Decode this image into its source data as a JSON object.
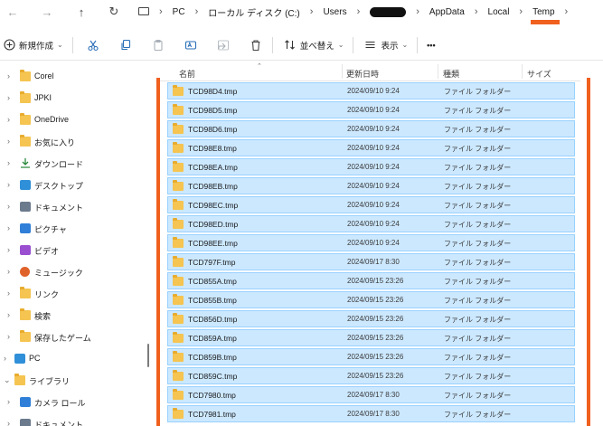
{
  "address": {
    "back_glyph": "←",
    "forward_glyph": "→",
    "up_glyph": "↑",
    "refresh_glyph": "↻",
    "breadcrumbs": [
      "PC",
      "ローカル ディスク (C:)",
      "Users",
      "",
      "AppData",
      "Local",
      "Temp"
    ]
  },
  "toolbar": {
    "new_label": "新規作成",
    "sort_label": "並べ替え",
    "view_label": "表示",
    "more_label": "•••"
  },
  "sidebar": {
    "items": [
      {
        "label": "Corel",
        "icon": "folder-icon"
      },
      {
        "label": "JPKI",
        "icon": "folder-icon"
      },
      {
        "label": "OneDrive",
        "icon": "folder-icon"
      },
      {
        "label": "お気に入り",
        "icon": "folder-icon"
      },
      {
        "label": "ダウンロード",
        "icon": "download-icon"
      },
      {
        "label": "デスクトップ",
        "icon": "desktop-icon"
      },
      {
        "label": "ドキュメント",
        "icon": "document-icon"
      },
      {
        "label": "ピクチャ",
        "icon": "pictures-icon"
      },
      {
        "label": "ビデオ",
        "icon": "video-icon"
      },
      {
        "label": "ミュージック",
        "icon": "music-icon"
      },
      {
        "label": "リンク",
        "icon": "folder-icon"
      },
      {
        "label": "検索",
        "icon": "folder-icon"
      },
      {
        "label": "保存したゲーム",
        "icon": "folder-icon"
      },
      {
        "label": "PC",
        "icon": "pc-icon"
      },
      {
        "label": "ライブラリ",
        "icon": "library-icon"
      },
      {
        "label": "カメラ ロール",
        "icon": "pictures-icon"
      },
      {
        "label": "ドキュメント",
        "icon": "document-icon"
      }
    ]
  },
  "columns": {
    "name": "名前",
    "modified": "更新日時",
    "type": "種類",
    "size": "サイズ"
  },
  "files": [
    {
      "name": "TCD98D4.tmp",
      "modified": "2024/09/10 9:24",
      "type": "ファイル フォルダー"
    },
    {
      "name": "TCD98D5.tmp",
      "modified": "2024/09/10 9:24",
      "type": "ファイル フォルダー"
    },
    {
      "name": "TCD98D6.tmp",
      "modified": "2024/09/10 9:24",
      "type": "ファイル フォルダー"
    },
    {
      "name": "TCD98E8.tmp",
      "modified": "2024/09/10 9:24",
      "type": "ファイル フォルダー"
    },
    {
      "name": "TCD98EA.tmp",
      "modified": "2024/09/10 9:24",
      "type": "ファイル フォルダー"
    },
    {
      "name": "TCD98EB.tmp",
      "modified": "2024/09/10 9:24",
      "type": "ファイル フォルダー"
    },
    {
      "name": "TCD98EC.tmp",
      "modified": "2024/09/10 9:24",
      "type": "ファイル フォルダー"
    },
    {
      "name": "TCD98ED.tmp",
      "modified": "2024/09/10 9:24",
      "type": "ファイル フォルダー"
    },
    {
      "name": "TCD98EE.tmp",
      "modified": "2024/09/10 9:24",
      "type": "ファイル フォルダー"
    },
    {
      "name": "TCD797F.tmp",
      "modified": "2024/09/17 8:30",
      "type": "ファイル フォルダー"
    },
    {
      "name": "TCD855A.tmp",
      "modified": "2024/09/15 23:26",
      "type": "ファイル フォルダー"
    },
    {
      "name": "TCD855B.tmp",
      "modified": "2024/09/15 23:26",
      "type": "ファイル フォルダー"
    },
    {
      "name": "TCD856D.tmp",
      "modified": "2024/09/15 23:26",
      "type": "ファイル フォルダー"
    },
    {
      "name": "TCD859A.tmp",
      "modified": "2024/09/15 23:26",
      "type": "ファイル フォルダー"
    },
    {
      "name": "TCD859B.tmp",
      "modified": "2024/09/15 23:26",
      "type": "ファイル フォルダー"
    },
    {
      "name": "TCD859C.tmp",
      "modified": "2024/09/15 23:26",
      "type": "ファイル フォルダー"
    },
    {
      "name": "TCD7980.tmp",
      "modified": "2024/09/17 8:30",
      "type": "ファイル フォルダー"
    },
    {
      "name": "TCD7981.tmp",
      "modified": "2024/09/17 8:30",
      "type": "ファイル フォルダー"
    }
  ],
  "colors": {
    "selection_fill": "#cce8ff",
    "selection_border": "#99d1ff",
    "annotation": "#f0601e",
    "folder": "#f5c451"
  }
}
